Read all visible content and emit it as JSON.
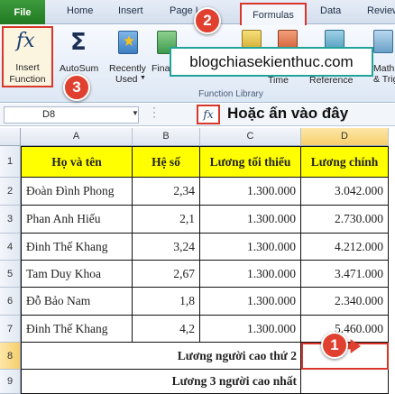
{
  "tabs": {
    "file": "File",
    "home": "Home",
    "insert": "Insert",
    "page_layout": "Page L",
    "formulas": "Formulas",
    "data": "Data",
    "review": "Review"
  },
  "ribbon": {
    "insert_function": [
      "Insert",
      "Function"
    ],
    "autosum": "AutoSum",
    "recently_used": [
      "Recently",
      "Used"
    ],
    "financial": "Finan",
    "time": "Time",
    "reference": "Reference",
    "math": [
      "Math",
      "& Trig"
    ],
    "group_label": "Function Library"
  },
  "watermark": "blogchiasekienthuc.com",
  "badges": {
    "one": "1",
    "two": "2",
    "three": "3"
  },
  "formula_bar": {
    "name_box": "D8",
    "fx": "fx",
    "hint": "Hoặc ấn vào đây"
  },
  "columns": [
    "A",
    "B",
    "C",
    "D"
  ],
  "rows_labels": [
    "1",
    "2",
    "3",
    "4",
    "5",
    "6",
    "7",
    "8",
    "9"
  ],
  "table": {
    "headers": [
      "Họ và tên",
      "Hệ số",
      "Lương tối thiểu",
      "Lương chính"
    ],
    "rows": [
      [
        "Đoàn Đình Phong",
        "2,34",
        "1.300.000",
        "3.042.000"
      ],
      [
        "Phan Anh Hiếu",
        "2,1",
        "1.300.000",
        "2.730.000"
      ],
      [
        "Đinh Thế Khang",
        "3,24",
        "1.300.000",
        "4.212.000"
      ],
      [
        "Tam Duy Khoa",
        "2,67",
        "1.300.000",
        "3.471.000"
      ],
      [
        "Đỗ Bảo Nam",
        "1,8",
        "1.300.000",
        "2.340.000"
      ],
      [
        "Đinh Thế Khang",
        "4,2",
        "1.300.000",
        "5.460.000"
      ]
    ],
    "row8_label": "Lương người cao thứ 2",
    "row9_label": "Lương 3 người cao nhất"
  }
}
